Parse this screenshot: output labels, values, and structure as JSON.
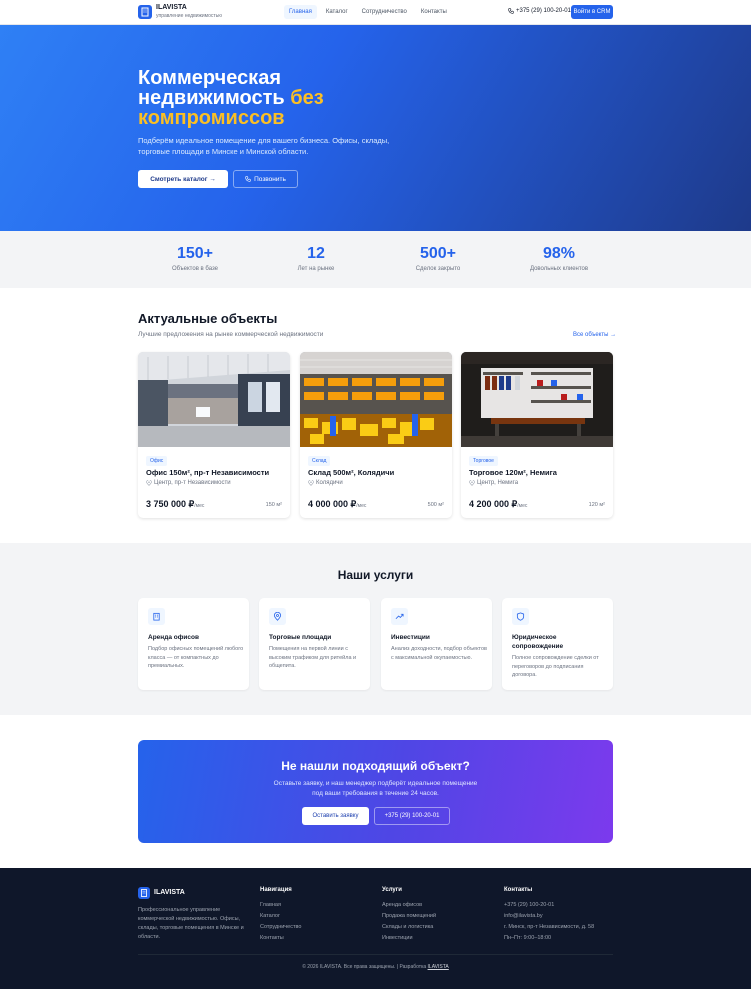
{
  "header": {
    "logo_name": "ILAVISTA",
    "logo_sub": "управление недвижимостью",
    "nav": [
      {
        "label": "Главная",
        "active": true
      },
      {
        "label": "Каталог",
        "active": false
      },
      {
        "label": "Сотрудничество",
        "active": false
      },
      {
        "label": "Контакты",
        "active": false
      }
    ],
    "phone": "+375 (29) 100-20-01",
    "crm_button": "Войти в CRM"
  },
  "hero": {
    "title_line1": "Коммерческая",
    "title_line2": "недвижимость",
    "title_accent": "без компромиссов",
    "subtitle": "Подберём идеальное помещение для вашего бизнеса. Офисы, склады, торговые площади в Минске и Минской области.",
    "catalog_button": "Смотреть каталог →",
    "call_button": "Позвонить"
  },
  "stats": [
    {
      "value": "150+",
      "label": "Объектов в базе"
    },
    {
      "value": "12",
      "label": "Лет на рынке"
    },
    {
      "value": "500+",
      "label": "Сделок закрыто"
    },
    {
      "value": "98%",
      "label": "Довольных клиентов"
    }
  ],
  "listings": {
    "title": "Актуальные объекты",
    "subtitle": "Лучшие предложения на рынке коммерческой недвижимости",
    "all_link": "Все объекты →",
    "items": [
      {
        "tag": "Офис",
        "title": "Офис 150м², пр-т Независимости",
        "location": "Центр, пр-т Независимости",
        "price": "3 750 000 ₽",
        "period": "/мес",
        "area": "150 м²"
      },
      {
        "tag": "Склад",
        "title": "Склад 500м², Колядичи",
        "location": "Колядичи",
        "price": "4 000 000 ₽",
        "period": "/мес",
        "area": "500 м²"
      },
      {
        "tag": "Торговое",
        "title": "Торговое 120м², Немига",
        "location": "Центр, Немига",
        "price": "4 200 000 ₽",
        "period": "/мес",
        "area": "120 м²"
      }
    ]
  },
  "services": {
    "title": "Наши услуги",
    "items": [
      {
        "icon": "building-icon",
        "title": "Аренда офисов",
        "desc": "Подбор офисных помещений любого класса — от компактных до премиальных."
      },
      {
        "icon": "map-pin-icon",
        "title": "Торговые площади",
        "desc": "Помещения на первой линии с высоким трафиком для ритейла и общепита."
      },
      {
        "icon": "trend-up-icon",
        "title": "Инвестиции",
        "desc": "Анализ доходности, подбор объектов с максимальной окупаемостью."
      },
      {
        "icon": "shield-icon",
        "title": "Юридическое сопровождение",
        "desc": "Полное сопровождение сделки от переговоров до подписания договора."
      }
    ]
  },
  "cta": {
    "title": "Не нашли подходящий объект?",
    "text": "Оставьте заявку, и наш менеджер подберёт идеальное помещение под ваши требования в течение 24 часов.",
    "request_button": "Оставить заявку",
    "phone_button": "+375 (29) 100-20-01"
  },
  "footer": {
    "logo_name": "ILAVISTA",
    "description": "Профессиональное управление коммерческой недвижимостью. Офисы, склады, торговые помещения в Минске и области.",
    "nav_title": "Навигация",
    "nav_links": [
      "Главная",
      "Каталог",
      "Сотрудничество",
      "Контакты"
    ],
    "services_title": "Услуги",
    "service_links": [
      "Аренда офисов",
      "Продажа помещений",
      "Склады и логистика",
      "Инвестиции"
    ],
    "contacts_title": "Контакты",
    "contacts": [
      "+375 (29) 100-20-01",
      "info@ilavista.by",
      "г. Минск, пр-т Независимости, д. 58",
      "Пн–Пт: 9:00–18:00"
    ],
    "copyright": "© 2026 ILAVISTA. Все права защищены.",
    "dev_prefix": "| Разработка",
    "dev_name": "ILAVISTA"
  },
  "colors": {
    "primary": "#2563eb",
    "accent": "#fbbf24",
    "footer_bg": "#0f172a"
  }
}
